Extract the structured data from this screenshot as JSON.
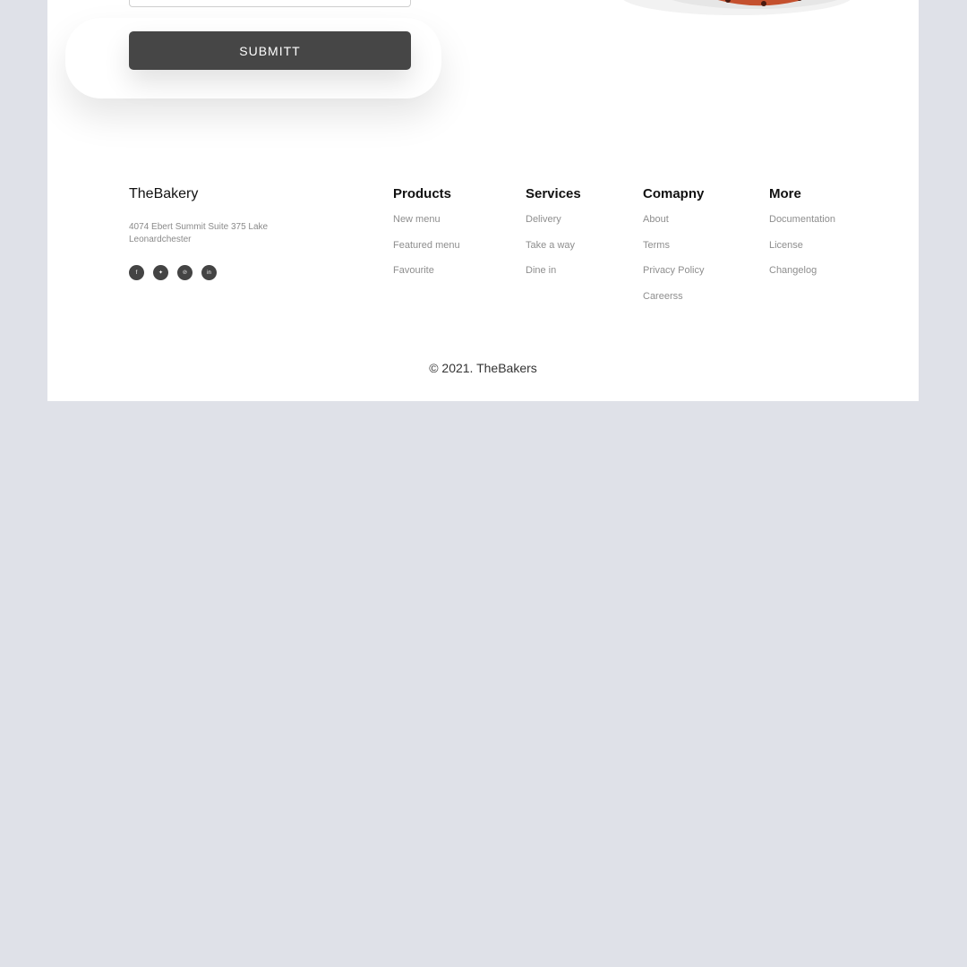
{
  "form": {
    "submit_label": "SUBMITT"
  },
  "footer": {
    "brand": "TheBakery",
    "address": "4074 Ebert Summit Suite 375 Lake Leonardchester",
    "socials": [
      {
        "icon": "facebook-icon",
        "glyph": "f"
      },
      {
        "icon": "twitter-icon",
        "glyph": "✦"
      },
      {
        "icon": "pinterest-icon",
        "glyph": "℗"
      },
      {
        "icon": "linkedin-icon",
        "glyph": "in"
      }
    ],
    "columns": [
      {
        "title": "Products",
        "links": [
          "New menu",
          "Featured menu",
          "Favourite"
        ]
      },
      {
        "title": "Services",
        "links": [
          "Delivery",
          "Take a way",
          "Dine in"
        ]
      },
      {
        "title": "Comapny",
        "links": [
          "About",
          "Terms",
          "Privacy Policy",
          "Careerss"
        ]
      },
      {
        "title": "More",
        "links": [
          "Documentation",
          "License",
          "Changelog"
        ]
      }
    ],
    "copyright": "© 2021. TheBakers"
  },
  "colors": {
    "page_bg": "#dfe1e8",
    "card_bg": "#ffffff",
    "button_bg": "#464646",
    "social_bg": "#444444"
  }
}
